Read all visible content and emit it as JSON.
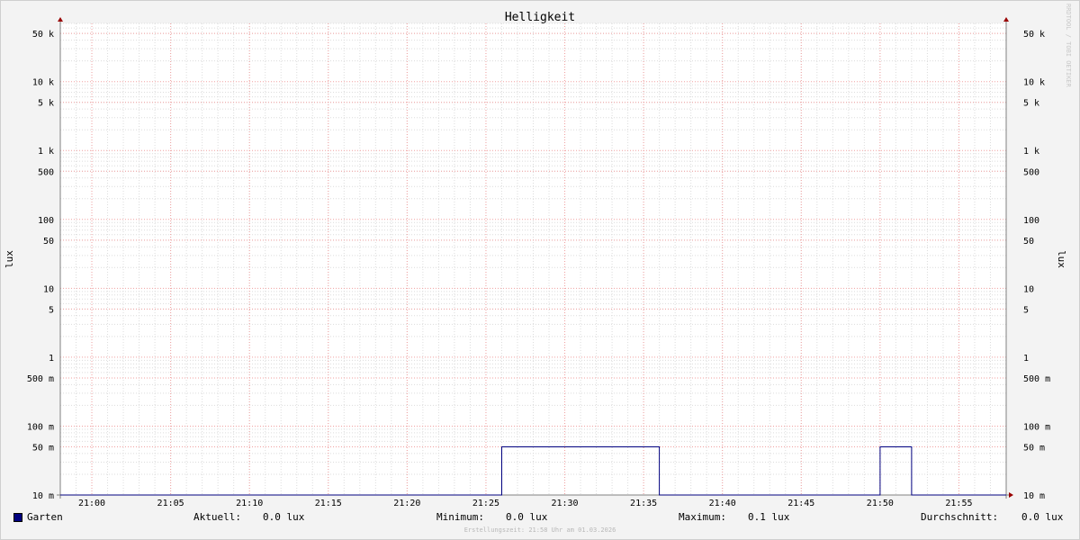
{
  "chart_data": {
    "type": "line",
    "title": "Helligkeit",
    "ylabel_left": "lux",
    "ylabel_right": "lux",
    "yscale": "log",
    "ylim": [
      0.01,
      70000
    ],
    "xlim": [
      "20:58",
      "21:58"
    ],
    "x_ticks": [
      "21:00",
      "21:05",
      "21:10",
      "21:15",
      "21:20",
      "21:25",
      "21:30",
      "21:35",
      "21:40",
      "21:45",
      "21:50",
      "21:55"
    ],
    "y_ticks": [
      {
        "value": 50000,
        "label": "50 k"
      },
      {
        "value": 10000,
        "label": "10 k"
      },
      {
        "value": 5000,
        "label": "5 k"
      },
      {
        "value": 1000,
        "label": "1 k"
      },
      {
        "value": 500,
        "label": "500"
      },
      {
        "value": 100,
        "label": "100"
      },
      {
        "value": 50,
        "label": "50"
      },
      {
        "value": 10,
        "label": "10"
      },
      {
        "value": 5,
        "label": "5"
      },
      {
        "value": 1,
        "label": "1"
      },
      {
        "value": 0.5,
        "label": "500 m"
      },
      {
        "value": 0.1,
        "label": "100 m"
      },
      {
        "value": 0.05,
        "label": "50 m"
      },
      {
        "value": 0.01,
        "label": "10 m"
      }
    ],
    "grid": true,
    "series": [
      {
        "name": "Garten",
        "color": "#00007f",
        "points": [
          [
            "20:58",
            0.01
          ],
          [
            "21:26",
            0.01
          ],
          [
            "21:26",
            0.05
          ],
          [
            "21:36",
            0.05
          ],
          [
            "21:36",
            0.01
          ],
          [
            "21:50",
            0.01
          ],
          [
            "21:50",
            0.05
          ],
          [
            "21:52",
            0.05
          ],
          [
            "21:52",
            0.01
          ],
          [
            "21:58",
            0.01
          ]
        ]
      }
    ]
  },
  "legend": {
    "series_name": "Garten",
    "current_label": "Aktuell:",
    "current_value": "0.0 lux",
    "min_label": "Minimum:",
    "min_value": "0.0 lux",
    "max_label": "Maximum:",
    "max_value": "0.1 lux",
    "avg_label": "Durchschnitt:",
    "avg_value": "0.0 lux"
  },
  "footer": "Erstellungszeit: 21:58 Uhr am 01.03.2026",
  "watermark": "RRDTOOL / TOBI OETIKER"
}
